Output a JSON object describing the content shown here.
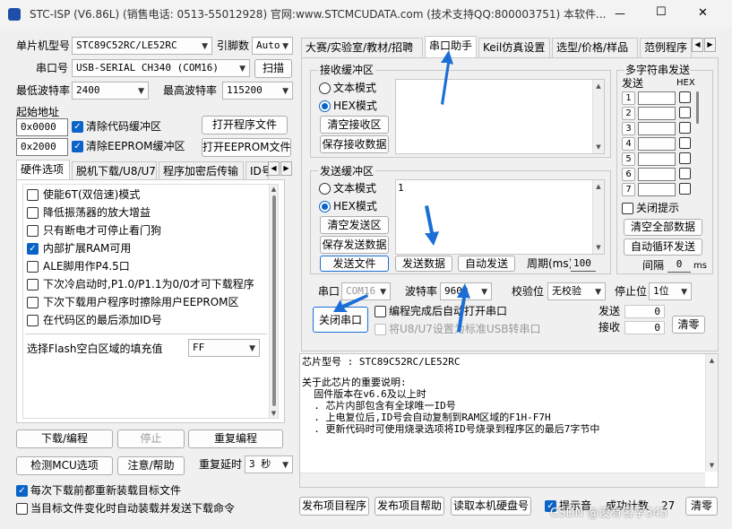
{
  "window": {
    "title": "STC-ISP (V6.86L) (销售电话: 0513-55012928) 官网:www.STCMCUDATA.com  (技术支持QQ:800003751) 本软件...",
    "min": "—",
    "max": "☐",
    "close": "✕"
  },
  "left": {
    "mcu_label": "单片机型号",
    "mcu_value": "STC89C52RC/LE52RC",
    "pin_label": "引脚数",
    "pin_value": "Auto",
    "port_label": "串口号",
    "port_value": "USB-SERIAL CH340 (COM16)",
    "scan": "扫描",
    "min_baud_label": "最低波特率",
    "min_baud_value": "2400",
    "max_baud_label": "最高波特率",
    "max_baud_value": "115200",
    "start_addr_label": "起始地址",
    "addr1": "0x0000",
    "addr1_check": "清除代码缓冲区",
    "open_prog": "打开程序文件",
    "addr2": "0x2000",
    "addr2_check": "清除EEPROM缓冲区",
    "open_eeprom": "打开EEPROM文件",
    "tabs": [
      "硬件选项",
      "脱机下载/U8/U7",
      "程序加密后传输",
      "ID号"
    ],
    "options": [
      {
        "label": "使能6T(双倍速)模式",
        "checked": false
      },
      {
        "label": "降低振荡器的放大增益",
        "checked": false
      },
      {
        "label": "只有断电才可停止看门狗",
        "checked": false
      },
      {
        "label": "内部扩展RAM可用",
        "checked": true
      },
      {
        "label": "ALE脚用作P4.5口",
        "checked": false
      },
      {
        "label": "下次冷启动时,P1.0/P1.1为0/0才可下载程序",
        "checked": false
      },
      {
        "label": "下次下载用户程序时擦除用户EEPROM区",
        "checked": false
      },
      {
        "label": "在代码区的最后添加ID号",
        "checked": false
      }
    ],
    "flash_fill_label": "选择Flash空白区域的填充值",
    "flash_fill_value": "FF",
    "download": "下载/编程",
    "stop": "停止",
    "reprogram": "重复编程",
    "detect": "检测MCU选项",
    "help": "注意/帮助",
    "delay_label": "重复延时",
    "delay_value": "3 秒",
    "reload_check": "每次下载前都重新装载目标文件",
    "auto_check": "当目标文件变化时自动装载并发送下载命令"
  },
  "right": {
    "tabs": [
      "大赛/实验室/教材/招聘",
      "串口助手",
      "Keil仿真设置",
      "选型/价格/样品",
      "范例程序"
    ],
    "recv_group": "接收缓冲区",
    "text_mode": "文本模式",
    "hex_mode": "HEX模式",
    "clear_recv": "清空接收区",
    "save_recv": "保存接收数据",
    "send_group": "发送缓冲区",
    "send_text": "1",
    "clear_send": "清空发送区",
    "save_send": "保存发送数据",
    "send_file": "发送文件",
    "send_data": "发送数据",
    "auto_send": "自动发送",
    "period_label": "周期(ms)",
    "period_value": "100",
    "multi_title": "多字符串发送",
    "send_col": "发送",
    "hex_col": "HEX",
    "multi_rows": [
      "1",
      "2",
      "3",
      "4",
      "5",
      "6",
      "7"
    ],
    "close_tip": "关闭提示",
    "clear_all": "清空全部数据",
    "auto_cycle": "自动循环发送",
    "interval_label": "间隔",
    "interval_value": "0",
    "interval_unit": "ms",
    "port_label": "串口",
    "port_value": "COM16",
    "baud_label": "波特率",
    "baud_value": "9600",
    "parity_label": "校验位",
    "parity_value": "无校验",
    "stop_label": "停止位",
    "stop_value": "1位",
    "close_port": "关闭串口",
    "auto_open": "编程完成后自动打开串口",
    "u8u7": "将U8/U7设置为标准USB转串口",
    "send_count_label": "发送",
    "send_count": "0",
    "recv_count_label": "接收",
    "recv_count": "0",
    "clear_count": "清零",
    "info_lines": [
      "芯片型号 : STC89C52RC/LE52RC",
      "",
      "关于此芯片的重要说明:",
      "  固件版本在v6.6及以上时",
      "  . 芯片内部包含有全球唯一ID号",
      "  . 上电复位后,ID号会自动复制到RAM区域的F1H-F7H",
      "  . 更新代码时可使用烧录选项将ID号烧录到程序区的最后7字节中"
    ],
    "publish_prog": "发布项目程序",
    "publish_help": "发布项目帮助",
    "read_disk": "读取本机硬盘号",
    "tip_check": "提示音",
    "success_label": "成功计数",
    "success_value": "27",
    "clear_btn": "清零"
  },
  "watermark": "CSDN @没有名字345",
  "accent": "#1a6ed6"
}
